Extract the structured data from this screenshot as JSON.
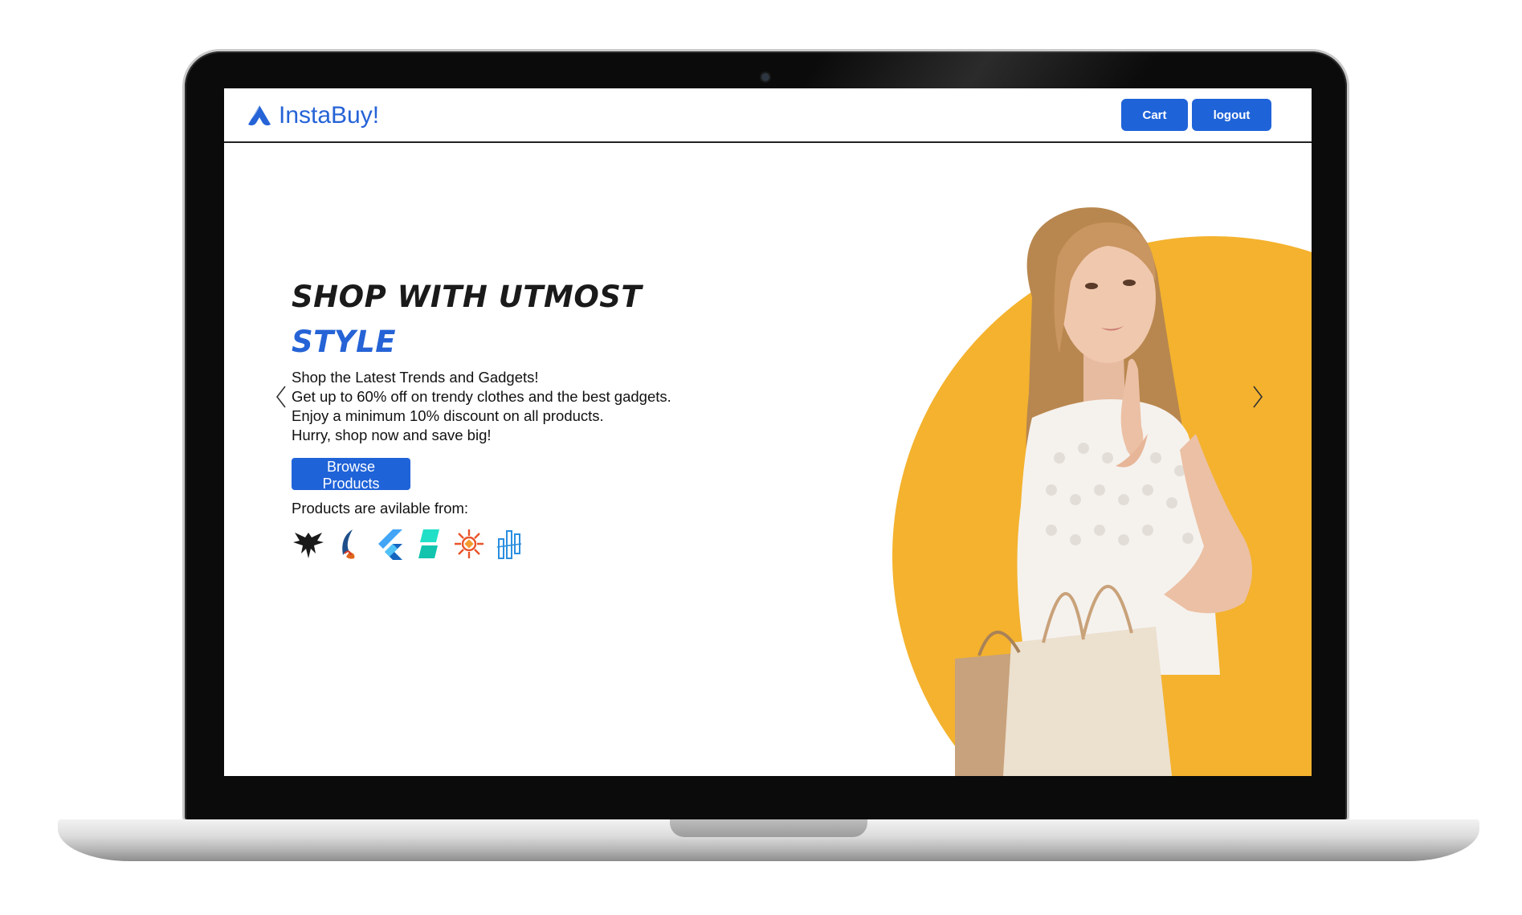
{
  "app": {
    "brand_name": "InstaBuy!",
    "brand_color": "#2563d6",
    "accent_color": "#f4b22e"
  },
  "navbar": {
    "cart_label": "Cart",
    "logout_label": "logout"
  },
  "hero": {
    "title_line1": "SHOP WITH UTMOST",
    "title_line2": "STYLE",
    "description": [
      "Shop the Latest Trends and Gadgets!",
      "Get up to 60% off on trendy clothes and the best gadgets.",
      "Enjoy a minimum 10% discount on all products.",
      "Hurry, shop now and save big!"
    ],
    "browse_button_label": "Browse Products",
    "available_from_label": "Products are avilable from:",
    "partner_logos": [
      "eagle-logo-icon",
      "feather-logo-icon",
      "flutter-logo-icon",
      "teal-block-logo-icon",
      "orange-sun-logo-icon",
      "blue-bars-logo-icon"
    ]
  },
  "carousel": {
    "prev_icon": "chevron-left-icon",
    "next_icon": "chevron-right-icon"
  }
}
